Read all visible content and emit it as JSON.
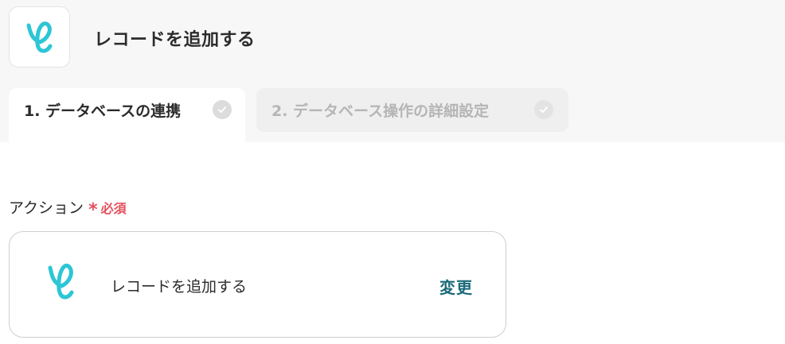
{
  "header": {
    "app_icon": "yoom-logo-icon",
    "title": "レコードを追加する"
  },
  "tabs": [
    {
      "label": "1. データベースの連携",
      "state": "active",
      "icon": "check-circle-icon"
    },
    {
      "label": "2. データベース操作の詳細設定",
      "state": "inactive",
      "icon": "check-circle-icon"
    }
  ],
  "action_field": {
    "label": "アクション",
    "required_mark": "*",
    "required_text": "必須",
    "selected_action": "レコードを追加する",
    "change_label": "変更"
  },
  "colors": {
    "brand_teal": "#2cc6d6",
    "required_red": "#e5505e",
    "link_teal": "#1a6a78",
    "top_background": "#f7f7f7"
  }
}
